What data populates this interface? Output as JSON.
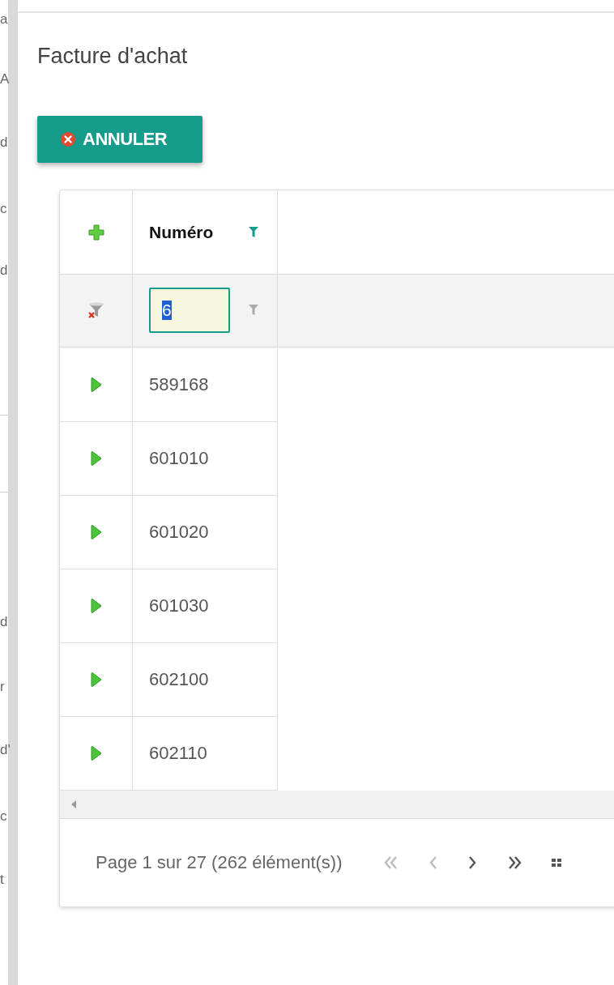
{
  "background_page": {
    "fragments": [
      "a",
      "A",
      "d",
      "c",
      "d",
      "d",
      "r",
      "d'",
      "c",
      "t"
    ]
  },
  "dialog": {
    "title": "Facture d'achat",
    "cancel_button": "ANNULER"
  },
  "grid": {
    "columns": [
      {
        "label": "Numéro",
        "filter_active": true
      }
    ],
    "filter_row": {
      "value": "6",
      "value_selected": true
    },
    "rows": [
      {
        "numero": "589168"
      },
      {
        "numero": "601010"
      },
      {
        "numero": "601020"
      },
      {
        "numero": "601030"
      },
      {
        "numero": "602100"
      },
      {
        "numero": "602110"
      }
    ],
    "pager": {
      "summary": "Page 1 sur 27 (262 élément(s))",
      "buttons": [
        {
          "kind": "first",
          "disabled": true
        },
        {
          "kind": "prev",
          "disabled": true
        },
        {
          "kind": "next",
          "disabled": false
        },
        {
          "kind": "last",
          "disabled": false
        },
        {
          "kind": "size",
          "disabled": false
        }
      ]
    }
  }
}
